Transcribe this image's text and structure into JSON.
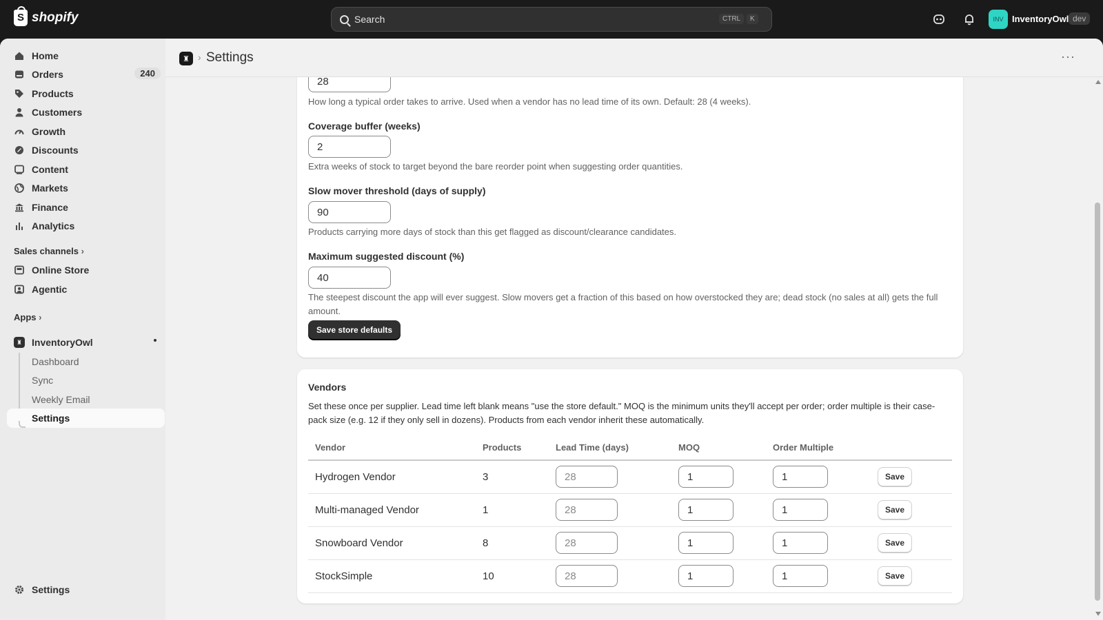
{
  "topbar": {
    "brand": "shopify",
    "search_placeholder": "Search",
    "shortcut_ctrl": "CTRL",
    "shortcut_key": "K",
    "avatar_initials": "INV",
    "store_name": "InventoryOwl",
    "env_badge": "dev"
  },
  "sidebar": {
    "items": [
      {
        "label": "Home",
        "icon": "home-icon"
      },
      {
        "label": "Orders",
        "icon": "orders-icon",
        "count": "240"
      },
      {
        "label": "Products",
        "icon": "tag-icon"
      },
      {
        "label": "Customers",
        "icon": "person-icon"
      },
      {
        "label": "Growth",
        "icon": "gauge-icon"
      },
      {
        "label": "Discounts",
        "icon": "discount-icon"
      },
      {
        "label": "Content",
        "icon": "content-icon"
      },
      {
        "label": "Markets",
        "icon": "globe-icon"
      },
      {
        "label": "Finance",
        "icon": "bank-icon"
      },
      {
        "label": "Analytics",
        "icon": "bar-chart-icon"
      }
    ],
    "sales_channels_label": "Sales channels",
    "channels": [
      {
        "label": "Online Store",
        "icon": "store-icon"
      },
      {
        "label": "Agentic",
        "icon": "agent-icon"
      }
    ],
    "apps_label": "Apps",
    "app": {
      "label": "InventoryOwl",
      "subitems": [
        "Dashboard",
        "Sync",
        "Weekly Email",
        "Settings"
      ]
    },
    "settings_label": "Settings"
  },
  "header": {
    "title": "Settings"
  },
  "store_defaults": {
    "lead_time_value": "28",
    "lead_time_help": "How long a typical order takes to arrive. Used when a vendor has no lead time of its own. Default: 28 (4 weeks).",
    "coverage_label": "Coverage buffer (weeks)",
    "coverage_value": "2",
    "coverage_help": "Extra weeks of stock to target beyond the bare reorder point when suggesting order quantities.",
    "slow_label": "Slow mover threshold (days of supply)",
    "slow_value": "90",
    "slow_help": "Products carrying more days of stock than this get flagged as discount/clearance candidates.",
    "discount_label": "Maximum suggested discount (%)",
    "discount_value": "40",
    "discount_help": "The steepest discount the app will ever suggest. Slow movers get a fraction of this based on how overstocked they are; dead stock (no sales at all) gets the full amount.",
    "save_label": "Save store defaults"
  },
  "vendors": {
    "title": "Vendors",
    "description": "Set these once per supplier. Lead time left blank means \"use the store default.\" MOQ is the minimum units they'll accept per order; order multiple is their case-pack size (e.g. 12 if they only sell in dozens). Products from each vendor inherit these automatically.",
    "columns": [
      "Vendor",
      "Products",
      "Lead Time (days)",
      "MOQ",
      "Order Multiple"
    ],
    "save_label": "Save",
    "rows": [
      {
        "vendor": "Hydrogen Vendor",
        "products": "3",
        "lead_placeholder": "28",
        "moq": "1",
        "multiple": "1"
      },
      {
        "vendor": "Multi-managed Vendor",
        "products": "1",
        "lead_placeholder": "28",
        "moq": "1",
        "multiple": "1"
      },
      {
        "vendor": "Snowboard Vendor",
        "products": "8",
        "lead_placeholder": "28",
        "moq": "1",
        "multiple": "1"
      },
      {
        "vendor": "StockSimple",
        "products": "10",
        "lead_placeholder": "28",
        "moq": "1",
        "multiple": "1"
      }
    ]
  }
}
